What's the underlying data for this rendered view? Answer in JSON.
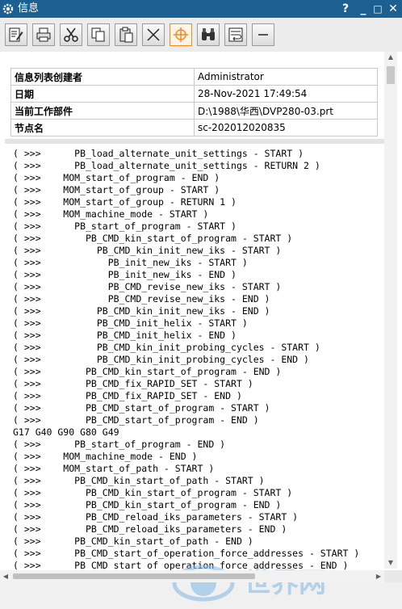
{
  "window": {
    "title": "信息",
    "help_label": "?",
    "minimize_label": "_",
    "maximize_label": "□",
    "close_label": "✕"
  },
  "toolbar": {
    "buttons": [
      {
        "icon": "save-icon"
      },
      {
        "icon": "print-icon"
      },
      {
        "icon": "cut-icon"
      },
      {
        "icon": "copy-icon"
      },
      {
        "icon": "paste-icon"
      },
      {
        "icon": "clear-icon"
      },
      {
        "icon": "target-icon",
        "active": true
      },
      {
        "icon": "find-icon"
      },
      {
        "icon": "wrap-icon"
      },
      {
        "icon": "minus-icon"
      }
    ]
  },
  "info_table": [
    {
      "key": "信息列表创建者",
      "value": "Administrator"
    },
    {
      "key": "日期",
      "value": "28-Nov-2021 17:49:54"
    },
    {
      "key": "当前工作部件",
      "value": "D:\\1988\\华西\\DVP280-03.prt"
    },
    {
      "key": "节点名",
      "value": "sc-202012020835"
    }
  ],
  "log_text": "( >>>      PB_load_alternate_unit_settings - START )\n( >>>      PB_load_alternate_unit_settings - RETURN 2 )\n( >>>    MOM_start_of_program - END )\n( >>>    MOM_start_of_group - START )\n( >>>    MOM_start_of_group - RETURN 1 )\n( >>>    MOM_machine_mode - START )\n( >>>      PB_start_of_program - START )\n( >>>        PB_CMD_kin_start_of_program - START )\n( >>>          PB_CMD_kin_init_new_iks - START )\n( >>>            PB_init_new_iks - START )\n( >>>            PB_init_new_iks - END )\n( >>>            PB_CMD_revise_new_iks - START )\n( >>>            PB_CMD_revise_new_iks - END )\n( >>>          PB_CMD_kin_init_new_iks - END )\n( >>>          PB_CMD_init_helix - START )\n( >>>          PB_CMD_init_helix - END )\n( >>>          PB_CMD_kin_init_probing_cycles - START )\n( >>>          PB_CMD_kin_init_probing_cycles - END )\n( >>>        PB_CMD_kin_start_of_program - END )\n( >>>        PB_CMD_fix_RAPID_SET - START )\n( >>>        PB_CMD_fix_RAPID_SET - END )\n( >>>        PB_CMD_start_of_program - START )\n( >>>        PB_CMD_start_of_program - END )\nG17 G40 G90 G80 G49\n( >>>      PB_start_of_program - END )\n( >>>    MOM_machine_mode - END )\n( >>>    MOM_start_of_path - START )\n( >>>      PB_CMD_kin_start_of_path - START )\n( >>>        PB_CMD_kin_start_of_program - START )\n( >>>        PB_CMD_kin_start_of_program - END )\n( >>>        PB_CMD_reload_iks_parameters - START )\n( >>>        PB_CMD_reload_iks_parameters - END )\n( >>>      PB_CMD_kin_start_of_path - END )\n( >>>      PB_CMD_start_of_operation_force_addresses - START )\n( >>>      PB_CMD_start_of_operation_force_addresses - END )",
  "watermark": {
    "text": "世界网"
  },
  "colors": {
    "titlebar": "#1c5f91",
    "active_button": "#f08a24"
  }
}
